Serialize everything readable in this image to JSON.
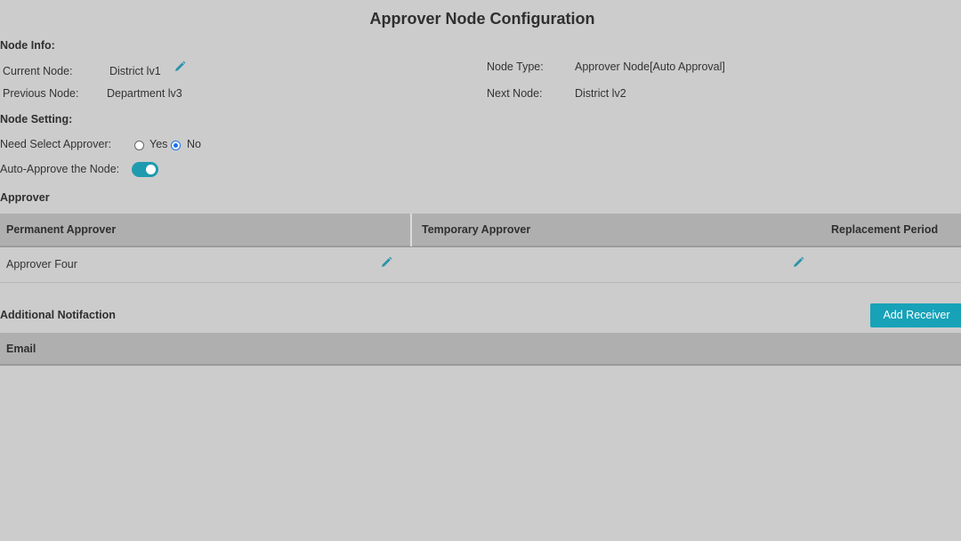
{
  "page": {
    "title": "Approver Node Configuration"
  },
  "node_info": {
    "heading": "Node Info:",
    "current_node": {
      "label": "Current Node:",
      "value": "District lv1"
    },
    "previous_node": {
      "label": "Previous Node:",
      "value": "Department lv3"
    },
    "node_type": {
      "label": "Node Type:",
      "value": "Approver Node[Auto Approval]"
    },
    "next_node": {
      "label": "Next Node:",
      "value": "District lv2"
    }
  },
  "node_setting": {
    "heading": "Node Setting:",
    "need_select_approver": {
      "label": "Need Select Approver:",
      "options": [
        "Yes",
        "No"
      ],
      "selected": "No"
    },
    "auto_approve": {
      "label": "Auto-Approve the Node:",
      "enabled": true
    }
  },
  "approver": {
    "heading": "Approver",
    "columns": [
      "Permanent Approver",
      "Temporary Approver",
      "Replacement Period"
    ],
    "rows": [
      {
        "permanent": "Approver Four",
        "temporary": "",
        "period": ""
      }
    ]
  },
  "additional_notification": {
    "heading": "Additional Notifaction",
    "add_button": "Add Receiver",
    "columns": [
      "Email"
    ]
  },
  "colors": {
    "accent": "#17a2b8",
    "background": "#cccccc",
    "table_header": "#afafaf"
  },
  "icons": {
    "edit": "pencil-icon"
  }
}
